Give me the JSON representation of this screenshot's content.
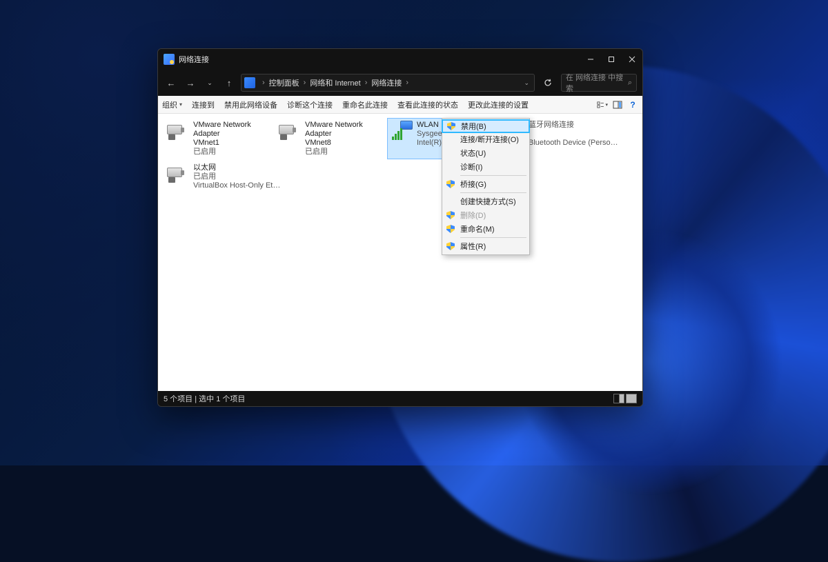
{
  "window": {
    "title": "网络连接"
  },
  "breadcrumb": [
    "控制面板",
    "网络和 Internet",
    "网络连接"
  ],
  "search": {
    "placeholder": "在 网络连接 中搜索"
  },
  "toolbar": {
    "organize": "组织",
    "connect": "连接到",
    "disable": "禁用此网络设备",
    "diagnose": "诊断这个连接",
    "rename": "重命名此连接",
    "status": "查看此连接的状态",
    "settings": "更改此连接的设置"
  },
  "adapters": [
    {
      "name": "VMware Network Adapter",
      "line2": "VMnet1",
      "status": "已启用"
    },
    {
      "name": "VMware Network Adapter",
      "line2": "VMnet8",
      "status": "已启用"
    },
    {
      "name": "WLAN",
      "line2": "Sysgeek 2",
      "device": "Intel(R) Wireless"
    },
    {
      "name": "蓝牙网络连接",
      "device": "Bluetooth Device (Personal Ar..."
    },
    {
      "name": "以太网",
      "status": "已启用",
      "device": "VirtualBox Host-Only Ethernet ..."
    }
  ],
  "context": [
    {
      "label": "禁用(B)",
      "shield": true,
      "highlighted": true
    },
    {
      "label": "连接/断开连接(O)"
    },
    {
      "label": "状态(U)"
    },
    {
      "label": "诊断(I)"
    },
    {
      "label": "桥接(G)",
      "shield": true
    },
    {
      "label": "创建快捷方式(S)"
    },
    {
      "label": "删除(D)",
      "shield": true,
      "disabled": true
    },
    {
      "label": "重命名(M)",
      "shield": true
    },
    {
      "label": "属性(R)",
      "shield": true
    }
  ],
  "status": {
    "text": "5 个项目  |  选中 1 个项目"
  }
}
